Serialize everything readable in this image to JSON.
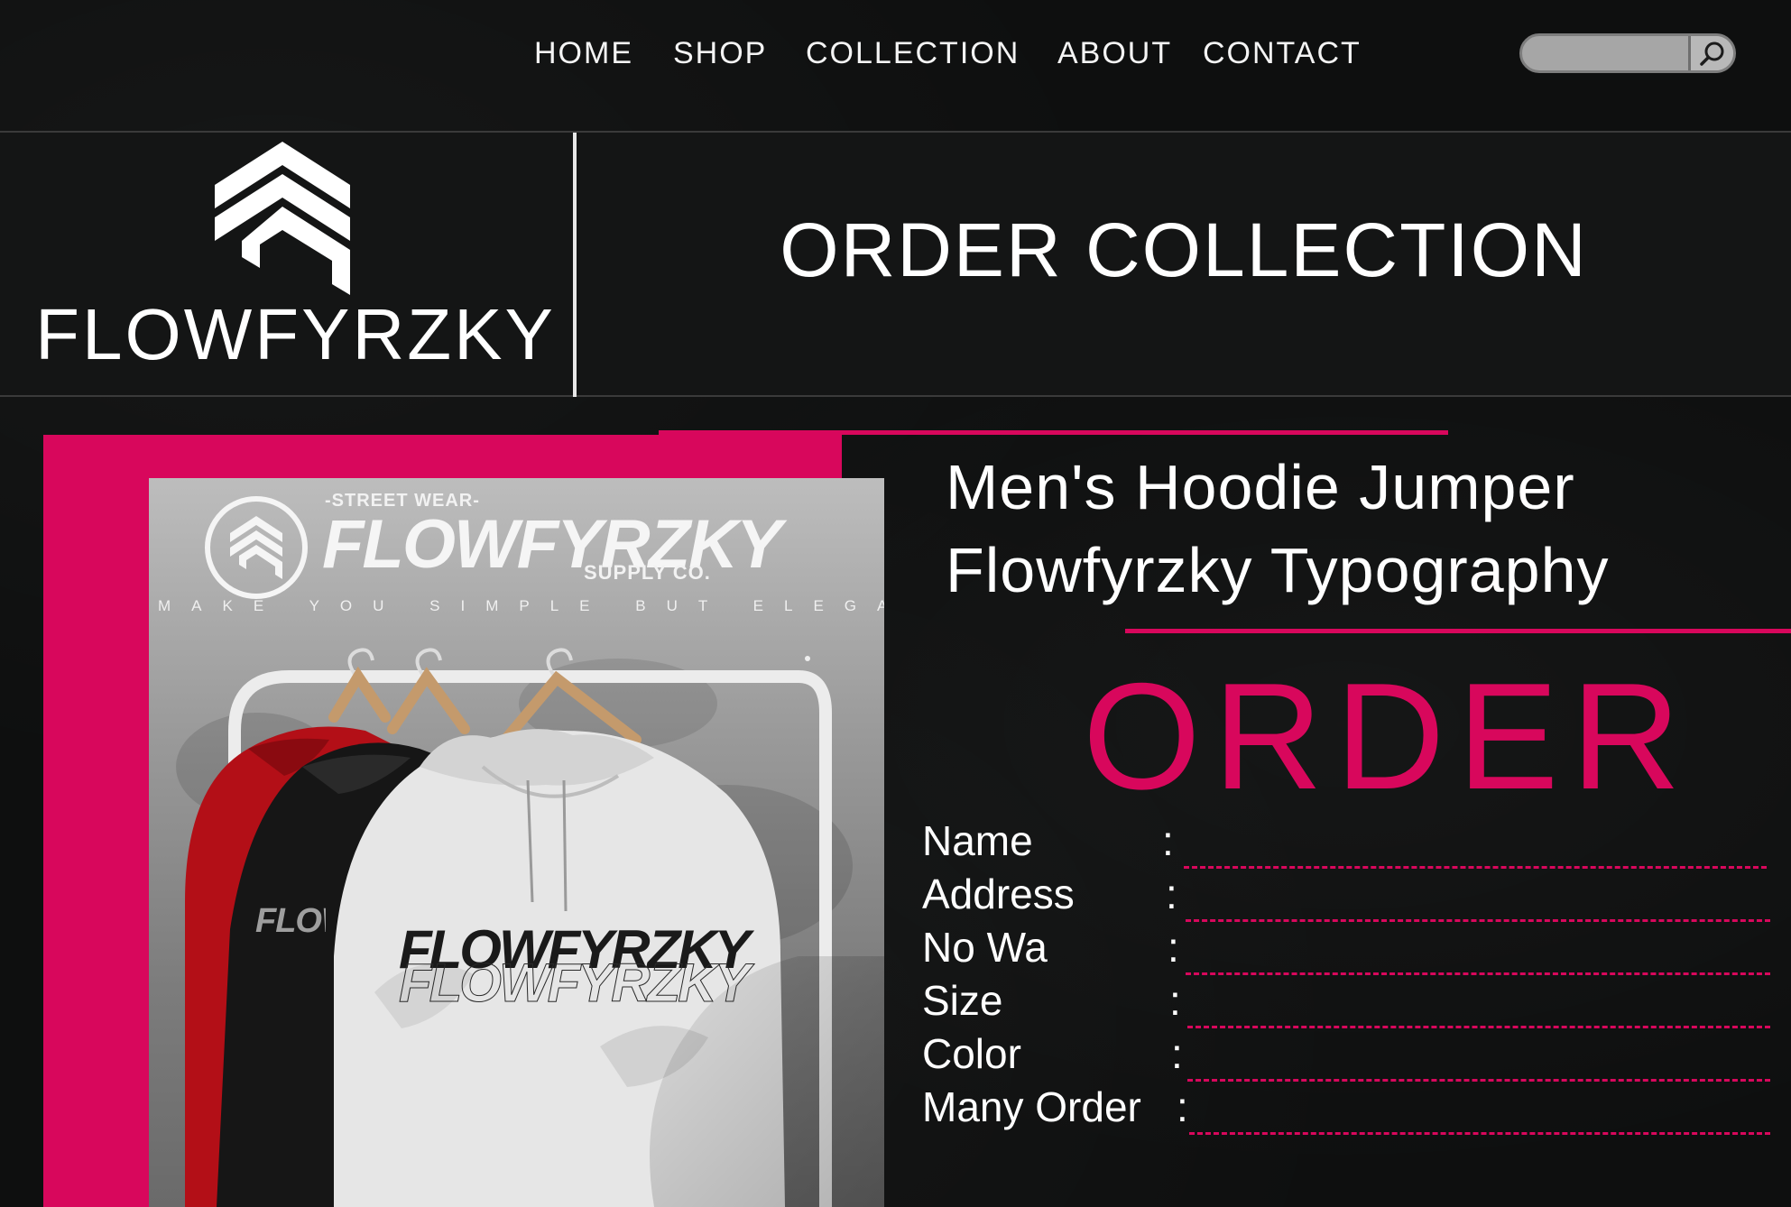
{
  "nav": {
    "items": [
      "HOME",
      "SHOP",
      "COLLECTION",
      "ABOUT",
      "CONTACT"
    ],
    "search_placeholder": ""
  },
  "brand": {
    "name": "FLOWFYRZKY"
  },
  "header": {
    "title": "ORDER COLLECTION"
  },
  "poster": {
    "streetwear": "-STREET WEAR-",
    "title": "FLOWFYRZKY",
    "supply": "SUPPLY CO.",
    "tagline": "MAKE YOU SIMPLE BUT ELEGANT!",
    "hoodie_print": "FLOWFYRZKY"
  },
  "product": {
    "line1": "Men's Hoodie Jumper",
    "line2": "Flowfyrzky Typography"
  },
  "order": {
    "heading": "ORDER",
    "fields": [
      {
        "label": "Name",
        "value": ""
      },
      {
        "label": "Address",
        "value": ""
      },
      {
        "label": "No Wa",
        "value": ""
      },
      {
        "label": "Size",
        "value": ""
      },
      {
        "label": "Color",
        "value": ""
      },
      {
        "label": "Many Order",
        "value": ""
      }
    ]
  },
  "colors": {
    "accent": "#d8075c",
    "background": "#0f1010",
    "text": "#ffffff"
  },
  "icons": {
    "search": "search-icon",
    "logo": "chevron-logo-icon"
  }
}
